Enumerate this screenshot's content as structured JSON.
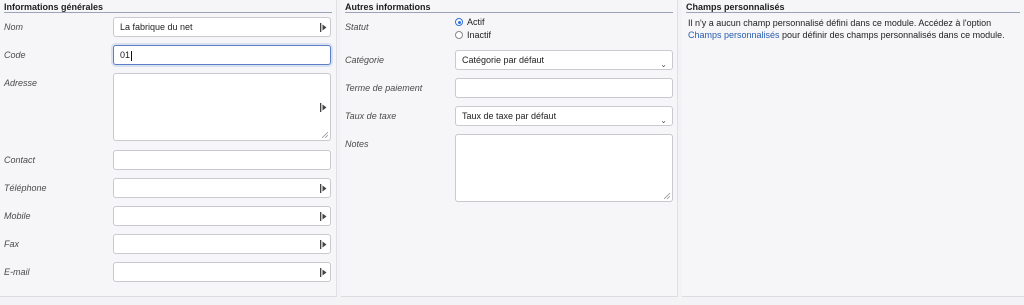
{
  "general": {
    "title": "Informations générales",
    "nom_label": "Nom",
    "nom_value": "La fabrique du net",
    "code_label": "Code",
    "code_value": "01",
    "adresse_label": "Adresse",
    "contact_label": "Contact",
    "telephone_label": "Téléphone",
    "mobile_label": "Mobile",
    "fax_label": "Fax",
    "email_label": "E-mail"
  },
  "other": {
    "title": "Autres informations",
    "statut_label": "Statut",
    "statut_options": [
      "Actif",
      "Inactif"
    ],
    "statut_selected": "Actif",
    "categorie_label": "Catégorie",
    "categorie_value": "Catégorie par défaut",
    "terme_label": "Terme de paiement",
    "taux_label": "Taux de taxe",
    "taux_value": "Taux de taxe par défaut",
    "notes_label": "Notes"
  },
  "custom": {
    "title": "Champs personnalisés",
    "text_before": "Il n'y a aucun champ personnalisé défini dans ce module. Accédez à l'option ",
    "link_text": "Champs personnalisés",
    "text_after": " pour définir des champs personnalisés dans ce module."
  }
}
